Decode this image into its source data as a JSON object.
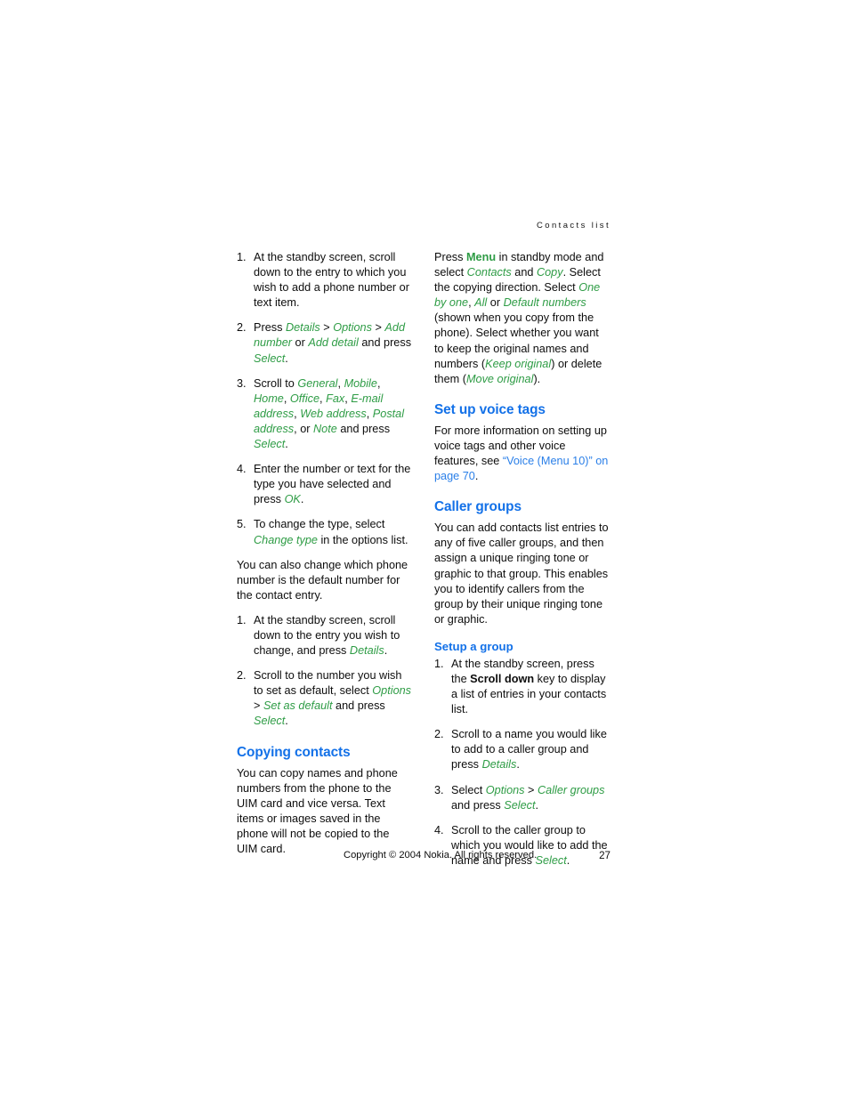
{
  "page": {
    "running_head": "Contacts list",
    "number": "27",
    "copyright": "Copyright © 2004 Nokia. All rights reserved."
  },
  "colors": {
    "heading_blue": "#1371e8",
    "ui_green": "#2e9c45",
    "link_blue": "#2a7fe8",
    "body_black": "#0d0d0d",
    "page_background": "#ffffff"
  },
  "left_column": {
    "list_add_detail": {
      "items": [
        {
          "number": "1.",
          "parts": [
            {
              "t": "At the standby screen, scroll down to the entry to which you wish to add a phone number or text item.",
              "s": "plain"
            }
          ]
        },
        {
          "number": "2.",
          "parts": [
            {
              "t": "Press ",
              "s": "plain"
            },
            {
              "t": "Details",
              "s": "ui"
            },
            {
              "t": " > ",
              "s": "gt"
            },
            {
              "t": "Options",
              "s": "ui"
            },
            {
              "t": " > ",
              "s": "gt"
            },
            {
              "t": "Add number",
              "s": "ui"
            },
            {
              "t": " or ",
              "s": "plain"
            },
            {
              "t": "Add detail",
              "s": "ui"
            },
            {
              "t": " and press ",
              "s": "plain"
            },
            {
              "t": "Select",
              "s": "ui"
            },
            {
              "t": ".",
              "s": "plain"
            }
          ]
        },
        {
          "number": "3.",
          "parts": [
            {
              "t": "Scroll to ",
              "s": "plain"
            },
            {
              "t": "General",
              "s": "ui"
            },
            {
              "t": ", ",
              "s": "plain"
            },
            {
              "t": "Mobile",
              "s": "ui"
            },
            {
              "t": ", ",
              "s": "plain"
            },
            {
              "t": "Home",
              "s": "ui"
            },
            {
              "t": ", ",
              "s": "plain"
            },
            {
              "t": "Office",
              "s": "ui"
            },
            {
              "t": ", ",
              "s": "plain"
            },
            {
              "t": "Fax",
              "s": "ui"
            },
            {
              "t": ", ",
              "s": "plain"
            },
            {
              "t": "E-mail address",
              "s": "ui"
            },
            {
              "t": ", ",
              "s": "plain"
            },
            {
              "t": "Web address",
              "s": "ui"
            },
            {
              "t": ", ",
              "s": "plain"
            },
            {
              "t": "Postal address",
              "s": "ui"
            },
            {
              "t": ", or ",
              "s": "plain"
            },
            {
              "t": "Note",
              "s": "ui"
            },
            {
              "t": " and press ",
              "s": "plain"
            },
            {
              "t": "Select",
              "s": "ui"
            },
            {
              "t": ".",
              "s": "plain"
            }
          ]
        },
        {
          "number": "4.",
          "parts": [
            {
              "t": "Enter the number or text for the type you have selected and press ",
              "s": "plain"
            },
            {
              "t": "OK",
              "s": "ui"
            },
            {
              "t": ".",
              "s": "plain"
            }
          ]
        },
        {
          "number": "5.",
          "parts": [
            {
              "t": "To change the type, select ",
              "s": "plain"
            },
            {
              "t": "Change type",
              "s": "ui"
            },
            {
              "t": " in the options list.",
              "s": "plain"
            }
          ]
        }
      ]
    },
    "default_number_intro": [
      {
        "t": "You can also change which phone number is the default number for the contact entry.",
        "s": "plain"
      }
    ],
    "list_default_number": {
      "items": [
        {
          "number": "1.",
          "parts": [
            {
              "t": "At the standby screen, scroll down to the entry you wish to change, and press ",
              "s": "plain"
            },
            {
              "t": "Details",
              "s": "ui"
            },
            {
              "t": ".",
              "s": "plain"
            }
          ]
        },
        {
          "number": "2.",
          "parts": [
            {
              "t": "Scroll to the number you wish to set as default, select ",
              "s": "plain"
            },
            {
              "t": "Options",
              "s": "ui"
            },
            {
              "t": " > ",
              "s": "gt"
            },
            {
              "t": "Set as default",
              "s": "ui"
            },
            {
              "t": " and press ",
              "s": "plain"
            },
            {
              "t": "Select",
              "s": "ui"
            },
            {
              "t": ".",
              "s": "plain"
            }
          ]
        }
      ]
    },
    "copying_contacts": {
      "heading": "Copying contacts",
      "body": [
        {
          "t": "You can copy names and phone numbers from the phone to the UIM card and vice versa. Text items or images saved in the phone will not be copied to the UIM card.",
          "s": "plain"
        }
      ]
    }
  },
  "right_column": {
    "copy_procedure": [
      {
        "t": "Press ",
        "s": "plain"
      },
      {
        "t": "Menu",
        "s": "uib"
      },
      {
        "t": " in standby mode and select ",
        "s": "plain"
      },
      {
        "t": "Contacts",
        "s": "ui"
      },
      {
        "t": " and ",
        "s": "plain"
      },
      {
        "t": "Copy",
        "s": "ui"
      },
      {
        "t": ". Select the copying direction. Select ",
        "s": "plain"
      },
      {
        "t": "One by one",
        "s": "ui"
      },
      {
        "t": ", ",
        "s": "plain"
      },
      {
        "t": "All",
        "s": "ui"
      },
      {
        "t": " or ",
        "s": "plain"
      },
      {
        "t": "Default numbers",
        "s": "ui"
      },
      {
        "t": " (shown when you copy from the phone). Select whether you want to keep the original names and numbers (",
        "s": "plain"
      },
      {
        "t": "Keep original",
        "s": "ui"
      },
      {
        "t": ") or delete them (",
        "s": "plain"
      },
      {
        "t": "Move original",
        "s": "ui"
      },
      {
        "t": ").",
        "s": "plain"
      }
    ],
    "voice_tags": {
      "heading": "Set up voice tags",
      "body": [
        {
          "t": "For more information on setting up voice tags and other voice features, see ",
          "s": "plain"
        },
        {
          "t": "“Voice (Menu 10)” on page 70",
          "s": "link"
        },
        {
          "t": ".",
          "s": "plain"
        }
      ]
    },
    "caller_groups": {
      "heading": "Caller groups",
      "body": [
        {
          "t": "You can add contacts list entries to any of five caller groups, and then assign a unique ringing tone or graphic to that group. This enables you to identify callers from the group by their unique ringing tone or graphic.",
          "s": "plain"
        }
      ],
      "subheading": "Setup a group",
      "list": {
        "items": [
          {
            "number": "1.",
            "parts": [
              {
                "t": "At the standby screen, press the ",
                "s": "plain"
              },
              {
                "t": "Scroll down",
                "s": "bk"
              },
              {
                "t": " key to display a list of entries in your contacts list.",
                "s": "plain"
              }
            ]
          },
          {
            "number": "2.",
            "parts": [
              {
                "t": "Scroll to a name you would like to add to a caller group and press ",
                "s": "plain"
              },
              {
                "t": "Details",
                "s": "ui"
              },
              {
                "t": ".",
                "s": "plain"
              }
            ]
          },
          {
            "number": "3.",
            "parts": [
              {
                "t": "Select ",
                "s": "plain"
              },
              {
                "t": "Options",
                "s": "ui"
              },
              {
                "t": " > ",
                "s": "gt"
              },
              {
                "t": "Caller groups",
                "s": "ui"
              },
              {
                "t": " and press ",
                "s": "plain"
              },
              {
                "t": "Select",
                "s": "ui"
              },
              {
                "t": ".",
                "s": "plain"
              }
            ]
          },
          {
            "number": "4.",
            "parts": [
              {
                "t": "Scroll to the caller group to which you would like to add the name and press ",
                "s": "plain"
              },
              {
                "t": "Select",
                "s": "ui"
              },
              {
                "t": ".",
                "s": "plain"
              }
            ]
          }
        ]
      }
    }
  }
}
